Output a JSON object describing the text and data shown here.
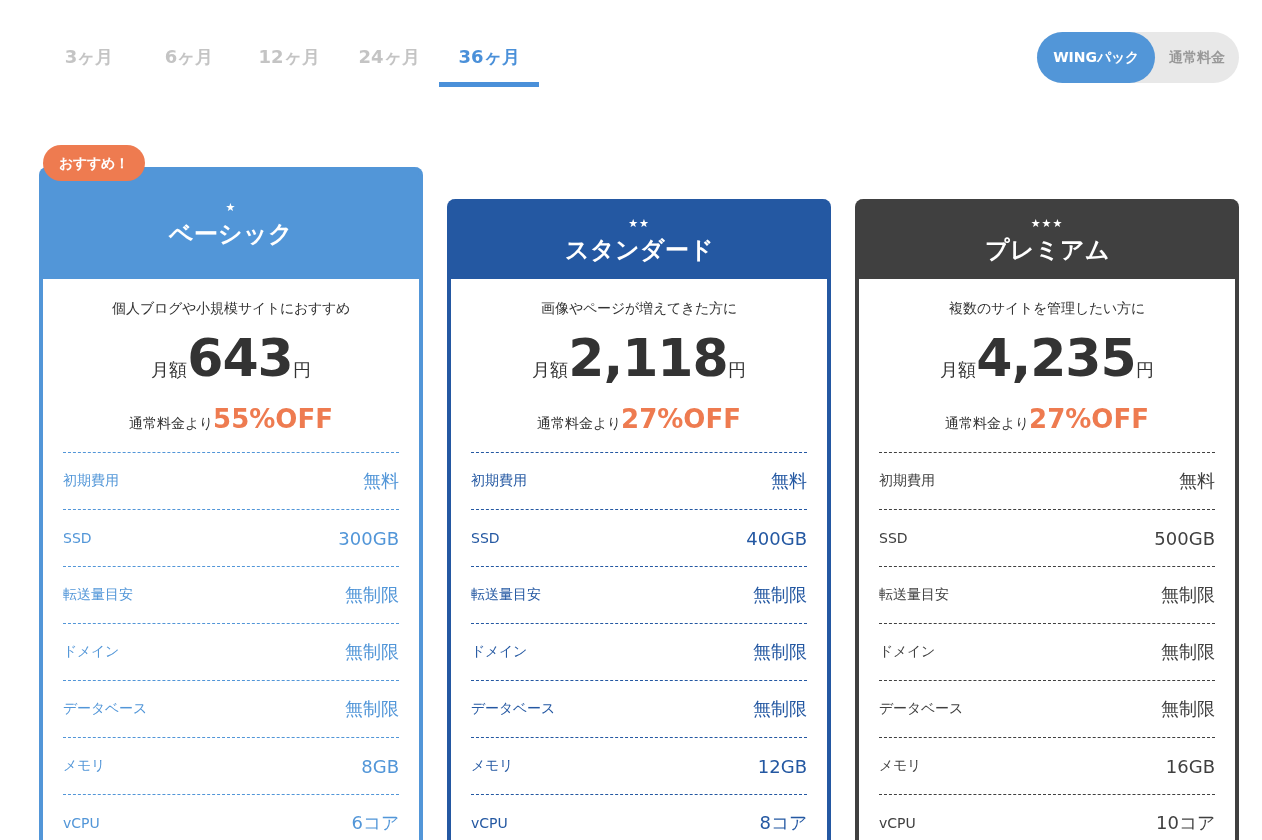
{
  "period_tabs": [
    {
      "label": "3ヶ月",
      "selected": false
    },
    {
      "label": "6ヶ月",
      "selected": false
    },
    {
      "label": "12ヶ月",
      "selected": false
    },
    {
      "label": "24ヶ月",
      "selected": false
    },
    {
      "label": "36ヶ月",
      "selected": true
    }
  ],
  "price_toggle": [
    {
      "label": "WINGパック",
      "selected": true
    },
    {
      "label": "通常料金",
      "selected": false
    }
  ],
  "plans": [
    {
      "badge": "おすすめ！",
      "grade_mark": "★",
      "name": "ベーシック",
      "color": "#5296d8",
      "tagline": "個人ブログや小規模サイトにおすすめ",
      "price_prefix": "月額",
      "price": "643",
      "price_unit": "円",
      "discount_prefix": "通常料金より",
      "discount": "55%OFF",
      "specs": [
        {
          "label": "初期費用",
          "value": "無料"
        },
        {
          "label": "SSD",
          "value": "300GB"
        },
        {
          "label": "転送量目安",
          "value": "無制限"
        },
        {
          "label": "ドメイン",
          "value": "無制限"
        },
        {
          "label": "データベース",
          "value": "無制限"
        },
        {
          "label": "メモリ",
          "value": "8GB"
        },
        {
          "label": "vCPU",
          "value": "6コア"
        }
      ]
    },
    {
      "grade_mark": "★★",
      "name": "スタンダード",
      "color": "#2458a2",
      "tagline": "画像やページが増えてきた方に",
      "price_prefix": "月額",
      "price": "2,118",
      "price_unit": "円",
      "discount_prefix": "通常料金より",
      "discount": "27%OFF",
      "specs": [
        {
          "label": "初期費用",
          "value": "無料"
        },
        {
          "label": "SSD",
          "value": "400GB"
        },
        {
          "label": "転送量目安",
          "value": "無制限"
        },
        {
          "label": "ドメイン",
          "value": "無制限"
        },
        {
          "label": "データベース",
          "value": "無制限"
        },
        {
          "label": "メモリ",
          "value": "12GB"
        },
        {
          "label": "vCPU",
          "value": "8コア"
        }
      ]
    },
    {
      "grade_mark": "★★★",
      "name": "プレミアム",
      "color": "#404040",
      "tagline": "複数のサイトを管理したい方に",
      "price_prefix": "月額",
      "price": "4,235",
      "price_unit": "円",
      "discount_prefix": "通常料金より",
      "discount": "27%OFF",
      "specs": [
        {
          "label": "初期費用",
          "value": "無料"
        },
        {
          "label": "SSD",
          "value": "500GB"
        },
        {
          "label": "転送量目安",
          "value": "無制限"
        },
        {
          "label": "ドメイン",
          "value": "無制限"
        },
        {
          "label": "データベース",
          "value": "無制限"
        },
        {
          "label": "メモリ",
          "value": "16GB"
        },
        {
          "label": "vCPU",
          "value": "10コア"
        }
      ]
    }
  ]
}
